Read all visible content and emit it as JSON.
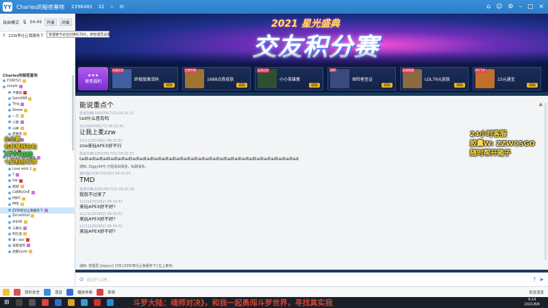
{
  "topbar": {
    "title": "Charles的秘密基地",
    "room_id": "2396481",
    "users": "32",
    "icons": [
      "home-icon",
      "user-icon",
      "settings-icon",
      "minimize-icon",
      "maximize-icon",
      "close-icon"
    ]
  },
  "left": {
    "mic_mode": "自由模式",
    "mic_time": "04:49",
    "tags": [
      "开麦",
      "闭麦"
    ],
    "tooltip": "管理者不必在切换队列内，按管理员设置",
    "queue_item": "ZZW李仕让我服务下",
    "root": "Charles的秘密基地",
    "tree": [
      {
        "name": "CSW(52)",
        "hl": false
      },
      {
        "name": "simple",
        "hl": false
      },
      {
        "name": "不服就",
        "hl": false
      },
      {
        "name": "Saint088",
        "hl": false
      },
      {
        "name": "Ting",
        "hl": false
      },
      {
        "name": "Zeeee",
        "hl": false
      },
      {
        "name": "一方",
        "hl": false
      },
      {
        "name": "小鹏",
        "hl": false
      },
      {
        "name": "山峰",
        "hl": false
      },
      {
        "name": "老朋友",
        "hl": false
      },
      {
        "name": "刷新",
        "hl": false
      },
      {
        "name": "初始化",
        "hl": false
      },
      {
        "name": "训练营",
        "hl": false
      },
      {
        "name": "Charles的秘密基地",
        "hl": false
      },
      {
        "name": "卡牌",
        "hl": false
      },
      {
        "name": "Love wish 2",
        "hl": false
      },
      {
        "name": "Y",
        "hl": false
      },
      {
        "name": "Ow",
        "hl": false
      },
      {
        "name": "孤城",
        "hl": false
      },
      {
        "name": "CaBByOnE",
        "hl": false
      },
      {
        "name": "PBPC",
        "hl": false
      },
      {
        "name": "MMJ",
        "hl": false
      },
      {
        "name": "ZZW李仕让我服务下",
        "hl": true
      },
      {
        "name": "Zervettind",
        "hl": false
      },
      {
        "name": "qiqiqk",
        "hl": false
      },
      {
        "name": "三朗头",
        "hl": false
      },
      {
        "name": "和红鱼",
        "hl": false
      },
      {
        "name": "掌一dor",
        "hl": false
      },
      {
        "name": "强者强有",
        "hl": false
      },
      {
        "name": "虎都syofc",
        "hl": false
      }
    ]
  },
  "overlay_left": {
    "l1": "企业鹅",
    "l2": "包邮黑钱包包",
    "l3": "ZZWE加油",
    "l4": "十级粉丝灯牌"
  },
  "banner": {
    "line1": "2021 星光盛典",
    "line2": "交友积分赛"
  },
  "rewards": {
    "vip": "尊贵福利",
    "items": [
      {
        "name": "终极版激活码",
        "btn": "领取",
        "color": "#3f5fa0",
        "corner": "充值礼包"
      },
      {
        "name": "1688点券皮肤",
        "btn": "领取",
        "color": "#a07430",
        "corner": "主播专属"
      },
      {
        "name": "小小英雄蛋",
        "btn": "领取",
        "color": "#2d5030",
        "corner": "云顶之弈"
      },
      {
        "name": "探险者圣证",
        "btn": "领取",
        "color": "#3a4a80",
        "corner": "DNF"
      },
      {
        "name": "LOL79元皮肤",
        "btn": "领取",
        "color": "#8a6a40",
        "corner": "英雄联盟"
      },
      {
        "name": "15元通宝",
        "btn": "领取",
        "color": "#c0702a",
        "corner": "QQ飞车"
      }
    ]
  },
  "chat": {
    "title": "能说重点个",
    "messages": [
      {
        "meta": "张凌华峰(1850781731)  06:32:11",
        "text": "tad什么思有吗",
        "size": "n"
      },
      {
        "meta": "刘(2483458277)  06:32:41",
        "text": "让我上麦zzw",
        "size": "big"
      },
      {
        "meta": "1(1212251962)  06:32:52",
        "text": "zzw来玩APEX好不行",
        "size": "n"
      },
      {
        "meta": "张凌华峰(1850781731)  06:32:57",
        "text": "tadtadtadtadtadtadtadtadtadtadtadtadtadtadtadtadtadtadtadtadtadtadtadtadtadtadtadtadtadtad",
        "size": "n"
      },
      {
        "notice": true,
        "text": "通知: Ziggy96与 已经退出频道，私聊消失。"
      },
      {
        "meta": "钟红鱼(2181750152)  06:33:25",
        "text": "TMD",
        "size": "huge"
      },
      {
        "meta": "张凌华峰(1850781731)  06:33:39",
        "text": "我就不过来了",
        "size": "n"
      },
      {
        "meta": "1(1212251962)  06:33:47",
        "text": "来玩APEX好不好?",
        "size": "n"
      },
      {
        "meta": "1(1212251962)  06:33:52",
        "text": "来玩APEX好不好?",
        "size": "n"
      },
      {
        "meta": "1(1212251962)  06:34:01",
        "text": "来玩APEX好不好?",
        "size": "n"
      }
    ],
    "bottom_notice": "通知: 管理员 [jiqiyiyi] 已将 [ZZW李仕让我服务下] 拉上麦序。"
  },
  "overlay_right": {
    "l1": "24小时客服",
    "l2": "胶囊W: ZZWCSGO",
    "l3": "随时帮开箱子"
  },
  "input": {
    "placeholder": "说点什么吧..."
  },
  "bottombar": {
    "items": [
      "我的发言",
      "语音",
      "播放伴奏",
      "表情",
      "发送消息"
    ]
  },
  "taskbar": {
    "marquee": "斗罗大陆：魂师对决》，和我一起勇闯斗罗世界，寻找真实我",
    "time": "6:14",
    "date": "2021/8/6"
  }
}
